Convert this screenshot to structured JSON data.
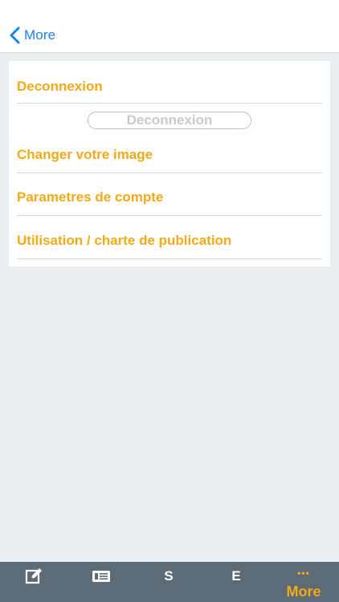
{
  "nav": {
    "back_label": "More",
    "back_icon": "chevron-left-icon"
  },
  "menu": {
    "items": [
      {
        "label": "Deconnexion"
      },
      {
        "label": "Changer votre image"
      },
      {
        "label": "Parametres de compte"
      },
      {
        "label": "Utilisation / charte de publication"
      }
    ],
    "logout_button_label": "Deconnexion"
  },
  "tab_bar": {
    "items": [
      {
        "icon": "edit-icon",
        "label": ""
      },
      {
        "icon": "news-list-icon",
        "label": ""
      },
      {
        "icon": "",
        "label": "S"
      },
      {
        "icon": "",
        "label": "E"
      },
      {
        "icon": "more-dots-icon",
        "dots": "•••",
        "label": "More",
        "selected": true
      }
    ]
  },
  "colors": {
    "accent_orange": "#f4a917",
    "ios_blue": "#1a82f5",
    "tab_bar_bg": "#5d6b76",
    "page_bg": "#ebeef1"
  }
}
